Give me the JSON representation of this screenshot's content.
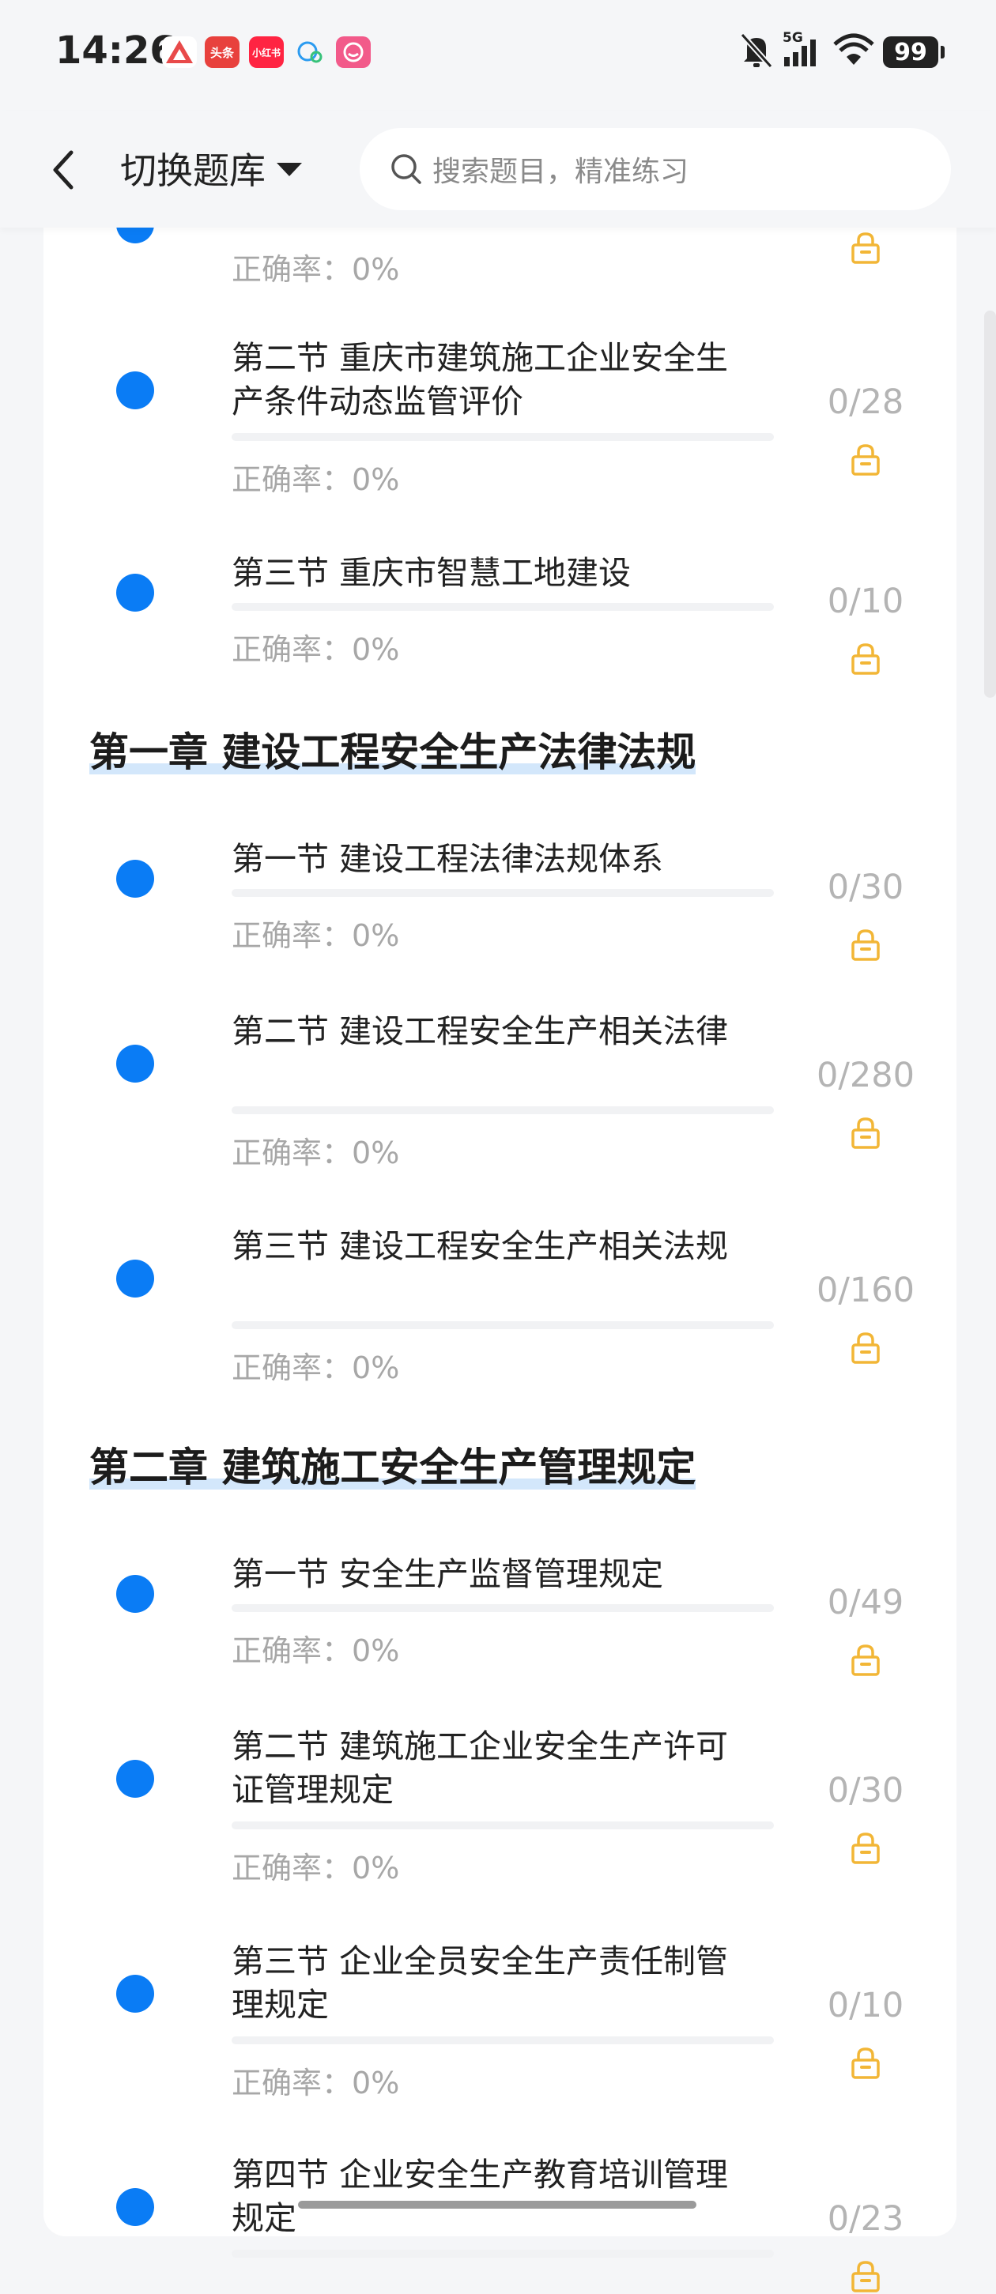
{
  "status_bar": {
    "time": "14:26",
    "apps": [
      {
        "name": "red-triangle-app",
        "label": "",
        "color": "#e84a4a"
      },
      {
        "name": "toutiao-app",
        "label": "头条",
        "color": "#e8413d"
      },
      {
        "name": "xiaohongshu-app",
        "label": "小红书",
        "color": "#ff2442"
      },
      {
        "name": "chat-bubble-app",
        "label": "",
        "color": "#2b9bf0"
      },
      {
        "name": "pink-face-app",
        "label": "",
        "color": "#f25a8a"
      }
    ],
    "network": "5G",
    "battery": "99"
  },
  "header": {
    "switch_bank_label": "切换题库",
    "search_placeholder": "搜索题目，精准练习"
  },
  "accent_color": "#0a7cf5",
  "lock_color": "#f2b636",
  "accuracy_prefix": "正确率：",
  "list": {
    "partial_top": {
      "accuracy": "0%"
    },
    "intro_sections": [
      {
        "title": "第二节 重庆市建筑施工企业安全生产条件动态监管评价",
        "count": "0/28",
        "accuracy": "0%"
      },
      {
        "title": "第三节 重庆市智慧工地建设",
        "count": "0/10",
        "accuracy": "0%"
      }
    ],
    "chapters": [
      {
        "title": "第一章 建设工程安全生产法律法规",
        "sections": [
          {
            "title": "第一节 建设工程法律法规体系",
            "count": "0/30",
            "accuracy": "0%"
          },
          {
            "title": "第二节 建设工程安全生产相关法律",
            "count": "0/280",
            "accuracy": "0%"
          },
          {
            "title": "第三节 建设工程安全生产相关法规",
            "count": "0/160",
            "accuracy": "0%"
          }
        ]
      },
      {
        "title": "第二章 建筑施工安全生产管理规定",
        "sections": [
          {
            "title": "第一节 安全生产监督管理规定",
            "count": "0/49",
            "accuracy": "0%"
          },
          {
            "title": "第二节 建筑施工企业安全生产许可证管理规定",
            "count": "0/30",
            "accuracy": "0%"
          },
          {
            "title": "第三节 企业全员安全生产责任制管理规定",
            "count": "0/10",
            "accuracy": "0%"
          },
          {
            "title": "第四节 企业安全生产教育培训管理规定",
            "count": "0/23",
            "accuracy": ""
          }
        ]
      }
    ]
  }
}
